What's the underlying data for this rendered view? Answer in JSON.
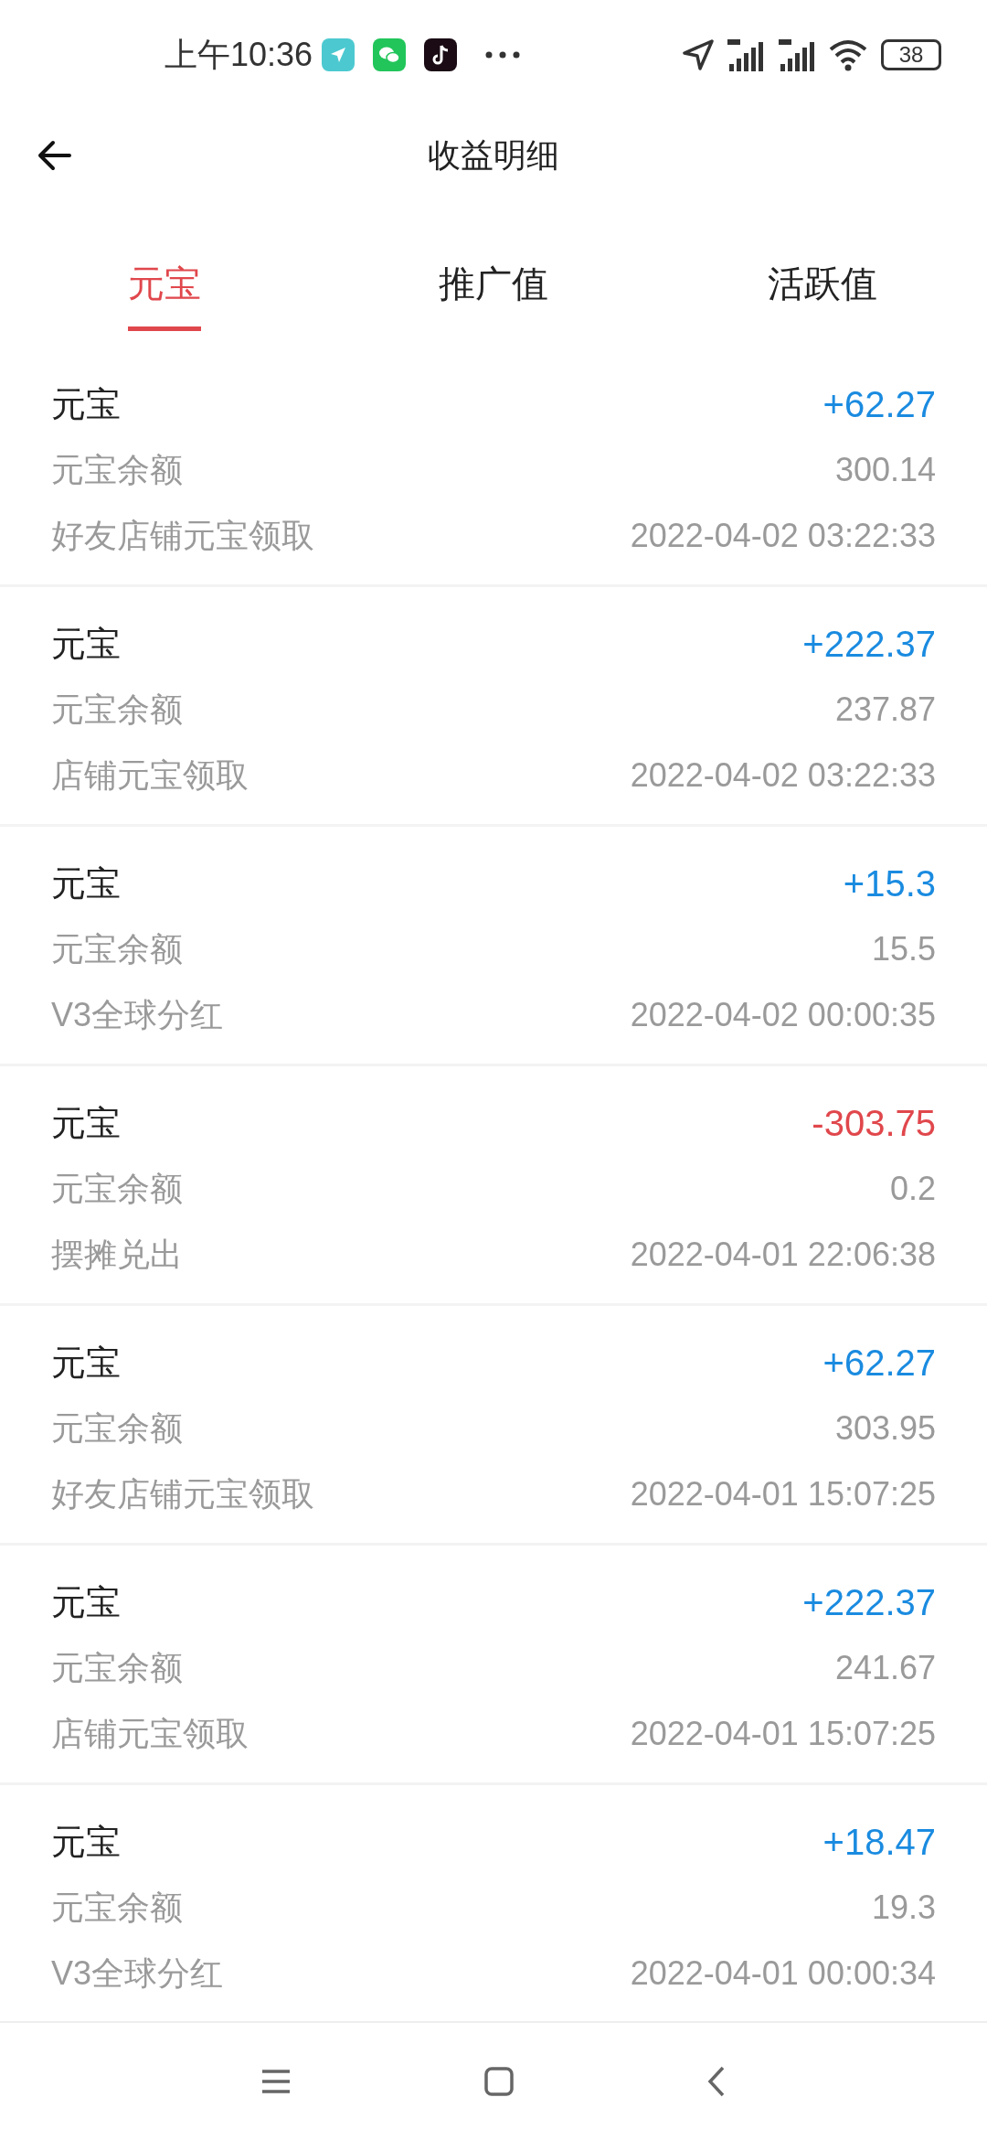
{
  "status_bar": {
    "time": "上午10:36",
    "battery": "38"
  },
  "header": {
    "title": "收益明细"
  },
  "tabs": [
    {
      "label": "元宝",
      "selected": true
    },
    {
      "label": "推广值",
      "selected": false
    },
    {
      "label": "活跃值",
      "selected": false
    }
  ],
  "records": [
    {
      "title": "元宝",
      "amount": "+62.27",
      "kind": "income",
      "balance_label": "元宝余额",
      "balance": "300.14",
      "description": "好友店铺元宝领取",
      "time": "2022-04-02 03:22:33"
    },
    {
      "title": "元宝",
      "amount": "+222.37",
      "kind": "income",
      "balance_label": "元宝余额",
      "balance": "237.87",
      "description": "店铺元宝领取",
      "time": "2022-04-02 03:22:33"
    },
    {
      "title": "元宝",
      "amount": "+15.3",
      "kind": "income",
      "balance_label": "元宝余额",
      "balance": "15.5",
      "description": "V3全球分红",
      "time": "2022-04-02 00:00:35"
    },
    {
      "title": "元宝",
      "amount": "-303.75",
      "kind": "expense",
      "balance_label": "元宝余额",
      "balance": "0.2",
      "description": "摆摊兑出",
      "time": "2022-04-01 22:06:38"
    },
    {
      "title": "元宝",
      "amount": "+62.27",
      "kind": "income",
      "balance_label": "元宝余额",
      "balance": "303.95",
      "description": "好友店铺元宝领取",
      "time": "2022-04-01 15:07:25"
    },
    {
      "title": "元宝",
      "amount": "+222.37",
      "kind": "income",
      "balance_label": "元宝余额",
      "balance": "241.67",
      "description": "店铺元宝领取",
      "time": "2022-04-01 15:07:25"
    },
    {
      "title": "元宝",
      "amount": "+18.47",
      "kind": "income",
      "balance_label": "元宝余额",
      "balance": "19.3",
      "description": "V3全球分红",
      "time": "2022-04-01 00:00:34"
    }
  ]
}
